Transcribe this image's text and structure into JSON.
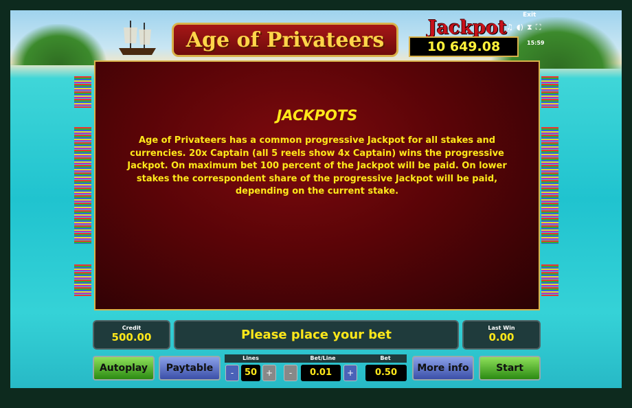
{
  "game": {
    "logo": "Age of Privateers"
  },
  "jackpot": {
    "title": "Jackpot",
    "amount": "10 649.08"
  },
  "system": {
    "exit": "Exit",
    "clock": "15:59",
    "icons": [
      "music-icon",
      "sound-icon",
      "resize-icon",
      "fullscreen-icon"
    ]
  },
  "info": {
    "heading": "JACKPOTS",
    "text": "Age of Privateers has a common progressive Jackpot for all stakes and currencies. 20x Captain (all 5 reels show 4x Captain) wins the progressive Jackpot. On maximum bet 100 percent of the Jackpot will be paid. On lower stakes the correspondent share of the progressive Jackpot will be paid, depending on the current stake."
  },
  "status": {
    "credit_label": "Credit",
    "credit": "500.00",
    "message": "Please place your bet",
    "lastwin_label": "Last Win",
    "lastwin": "0.00"
  },
  "controls": {
    "autoplay": "Autoplay",
    "paytable": "Paytable",
    "lines_label": "Lines",
    "lines": "50",
    "betline_label": "Bet/Line",
    "betline": "0.01",
    "bet_label": "Bet",
    "bet": "0.50",
    "minus": "-",
    "plus": "+",
    "more_info": "More info",
    "start": "Start"
  }
}
